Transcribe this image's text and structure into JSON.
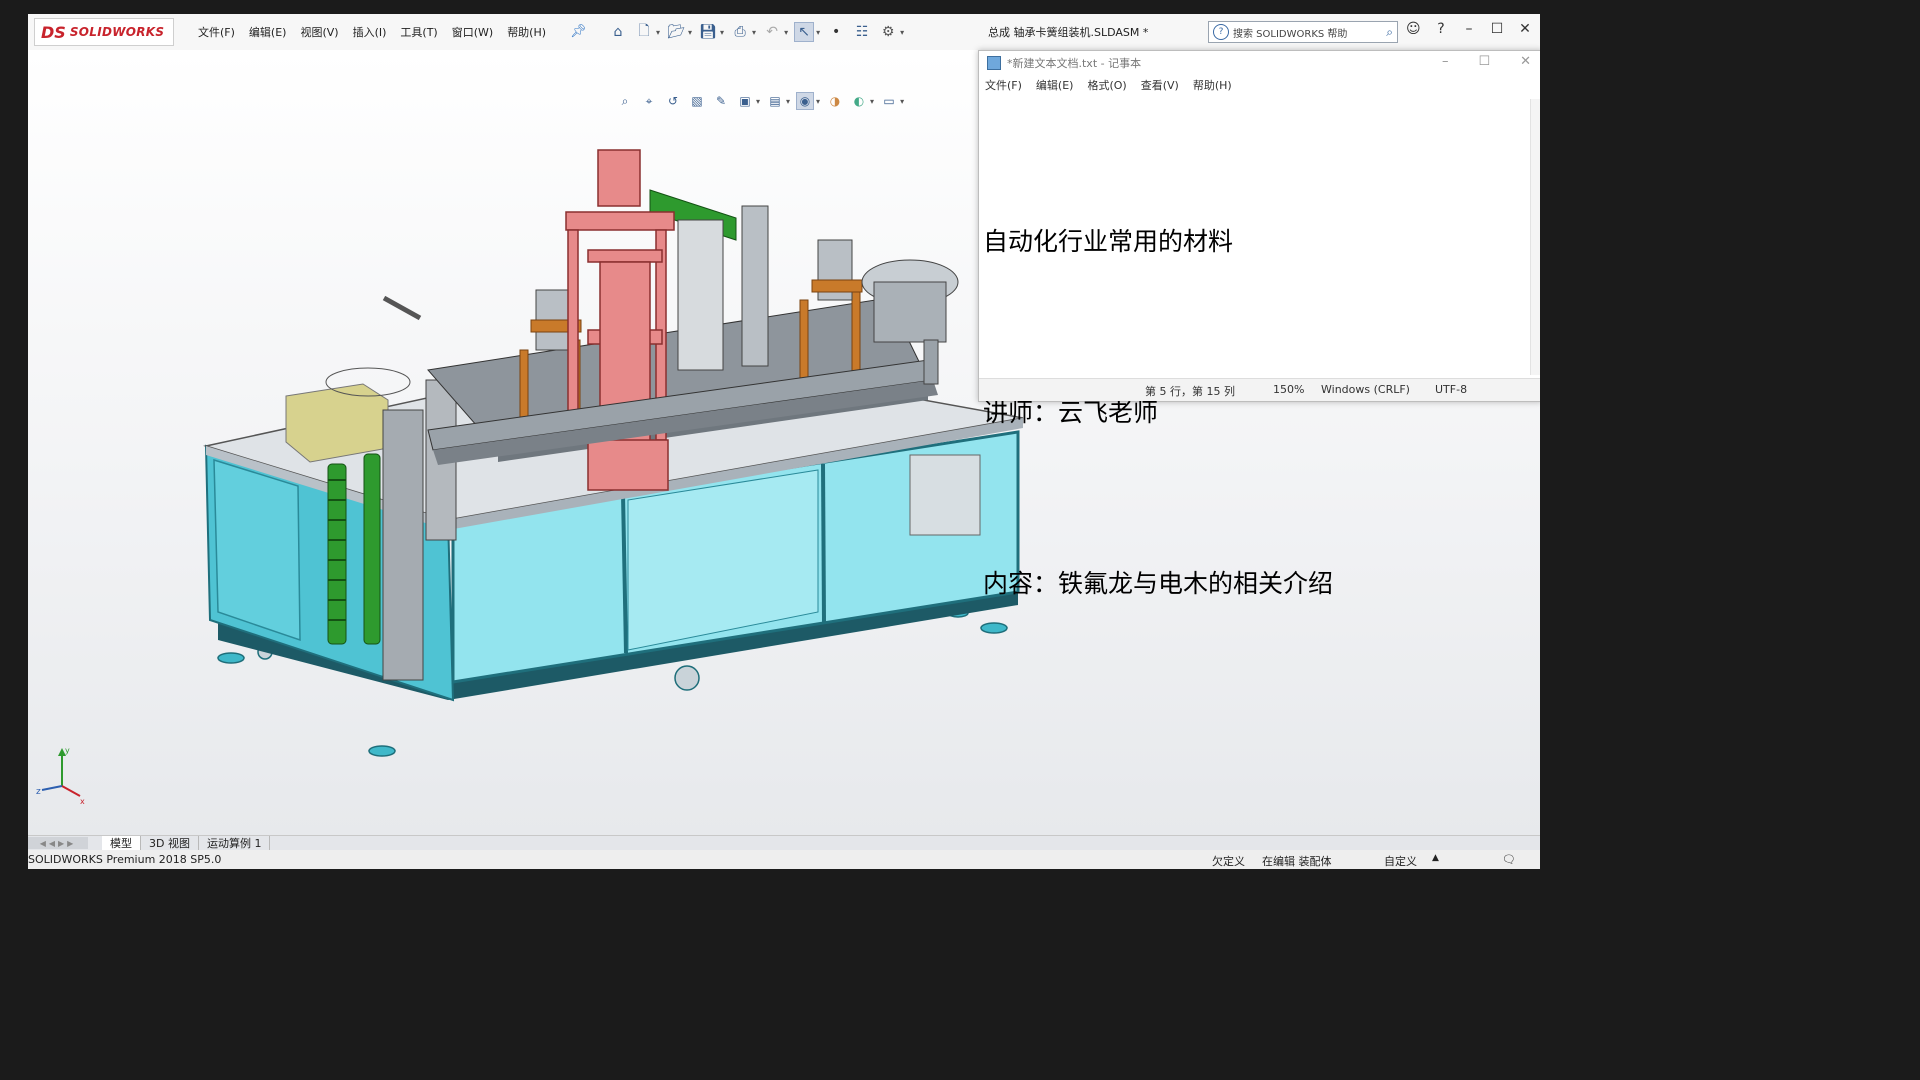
{
  "app": {
    "logo_ds": "DS",
    "logo_text": "SOLIDWORKS",
    "menus": [
      "文件(F)",
      "编辑(E)",
      "视图(V)",
      "插入(I)",
      "工具(T)",
      "窗口(W)",
      "帮助(H)"
    ],
    "document_title": "总成 轴承卡簧组装机.SLDASM *",
    "search_placeholder": "搜索 SOLIDWORKS 帮助",
    "window_controls": [
      "user-icon",
      "help-icon",
      "minimize-icon",
      "maximize-icon",
      "close-icon"
    ]
  },
  "toolbar": {
    "icons": [
      "home-icon",
      "new-icon",
      "open-icon",
      "save-icon",
      "print-icon",
      "undo-icon",
      "select-icon",
      "traffic-light-icon",
      "file-properties-icon",
      "options-icon"
    ]
  },
  "heads_up": {
    "icons": [
      "zoom-to-fit-icon",
      "zoom-area-icon",
      "previous-view-icon",
      "section-view-icon",
      "dynamic-annotation-icon",
      "view-orientation-icon",
      "display-style-icon",
      "hide-show-icon",
      "edit-appearance-icon",
      "scene-icon",
      "view-settings-icon"
    ]
  },
  "notepad": {
    "title": "*新建文本文档.txt - 记事本",
    "menus": [
      "文件(F)",
      "编辑(E)",
      "格式(O)",
      "查看(V)",
      "帮助(H)"
    ],
    "lines": [
      "自动化行业常用的材料",
      "讲师：云飞老师",
      "内容：铁氟龙与电木的相关介绍"
    ],
    "status": {
      "position": "第 5 行，第 15 列",
      "zoom": "150%",
      "line_ending": "Windows (CRLF)",
      "encoding": "UTF-8"
    }
  },
  "bottom_tabs": [
    "模型",
    "3D 视图",
    "运动算例 1"
  ],
  "statusbar": {
    "product": "SOLIDWORKS Premium 2018 SP5.0",
    "state": "欠定义",
    "mode": "在编辑 装配体",
    "units": "自定义"
  },
  "colors": {
    "frame_cyan": "#3fb8c9",
    "glass": "#8ee0ea",
    "accent_red": "#e78a8a",
    "accent_green": "#2e9a2e",
    "accent_orange": "#c97a2a",
    "logo_red": "#c8232c"
  }
}
